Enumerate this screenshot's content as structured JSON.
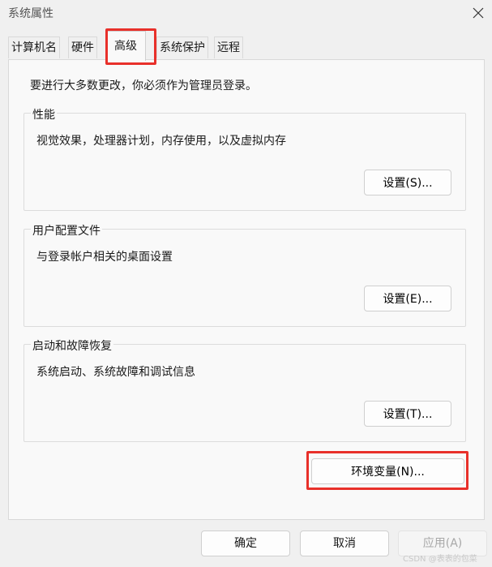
{
  "window": {
    "title": "系统属性"
  },
  "tabs": [
    {
      "label": "计算机名"
    },
    {
      "label": "硬件"
    },
    {
      "label": "高级"
    },
    {
      "label": "系统保护"
    },
    {
      "label": "远程"
    }
  ],
  "panel": {
    "intro": "要进行大多数更改，你必须作为管理员登录。",
    "groups": [
      {
        "title": "性能",
        "description": "视觉效果，处理器计划，内存使用，以及虚拟内存",
        "button": "设置(S)..."
      },
      {
        "title": "用户配置文件",
        "description": "与登录帐户相关的桌面设置",
        "button": "设置(E)..."
      },
      {
        "title": "启动和故障恢复",
        "description": "系统启动、系统故障和调试信息",
        "button": "设置(T)..."
      }
    ],
    "env_button": "环境变量(N)..."
  },
  "footer": {
    "ok": "确定",
    "cancel": "取消",
    "apply": "应用(A)"
  },
  "watermark": "CSDN @表表的包菜",
  "colors": {
    "highlight": "#e8302a",
    "panel_bg": "#f9f9f9",
    "window_bg": "#f0f0f0"
  }
}
